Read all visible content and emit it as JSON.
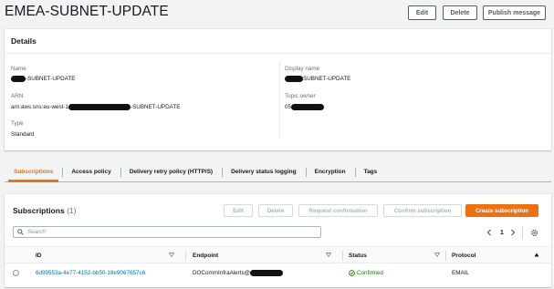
{
  "header": {
    "title": "EMEA-SUBNET-UPDATE",
    "edit_label": "Edit",
    "delete_label": "Delete",
    "publish_label": "Publish message"
  },
  "details": {
    "heading": "Details",
    "name_label": "Name",
    "name_value": "-SUBNET-UPDATE",
    "arn_label": "ARN",
    "arn_prefix": "arn:aws:sns:eu-west-1",
    "arn_suffix": "-SUBNET-UPDATE",
    "type_label": "Type",
    "type_value": "Standard",
    "display_name_label": "Display name",
    "display_name_value": "SUBNET-UPDATE",
    "topic_owner_label": "Topic owner",
    "topic_owner_value": "05"
  },
  "tabs": [
    {
      "label": "Subscriptions",
      "active": true
    },
    {
      "label": "Access policy"
    },
    {
      "label": "Delivery retry policy (HTTP/S)"
    },
    {
      "label": "Delivery status logging"
    },
    {
      "label": "Encryption"
    },
    {
      "label": "Tags"
    }
  ],
  "subscriptions": {
    "title": "Subscriptions",
    "count": "(1)",
    "buttons": {
      "edit": "Edit",
      "delete": "Delete",
      "request_confirmation": "Request confirmation",
      "confirm_subscription": "Confirm subscription",
      "create_subscription": "Create subscription"
    },
    "search_placeholder": "Search",
    "page": "1",
    "columns": [
      "ID",
      "Endpoint",
      "Status",
      "Protocol"
    ],
    "rows": [
      {
        "id": "6d99553a-4e77-4152-bb50-18e9067657c6",
        "endpoint": "DOCommInfraAlerts@",
        "status": "Confirmed",
        "protocol": "EMAIL"
      }
    ]
  },
  "colors": {
    "accent": "#ec7211",
    "link": "#0073bb",
    "success": "#1d8102",
    "background": "#f2f3f3"
  }
}
